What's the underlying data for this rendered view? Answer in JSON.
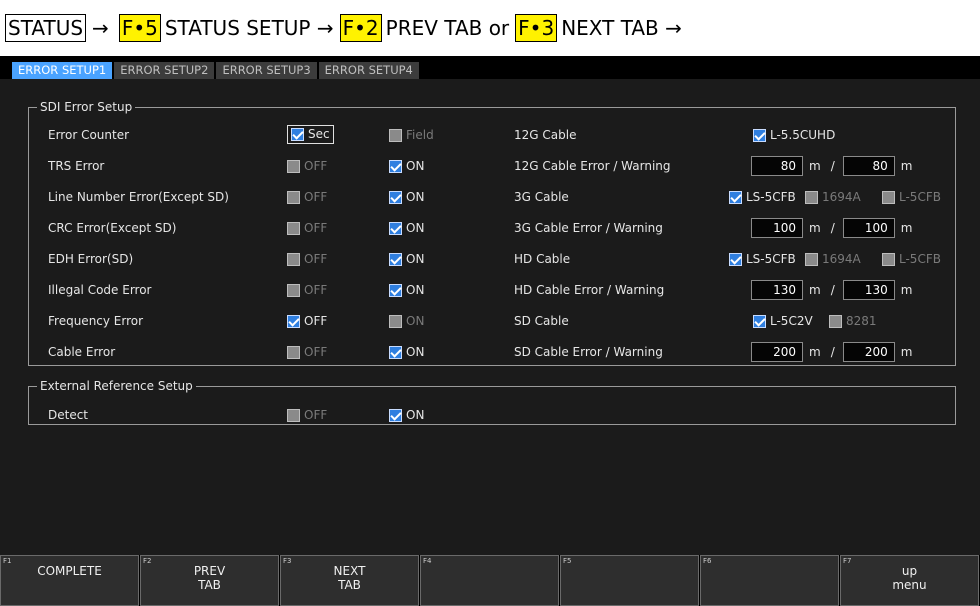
{
  "header": {
    "status": "STATUS",
    "arrow": "→",
    "f5_key": "F•5",
    "f5_text": "STATUS SETUP →",
    "f2_key": "F•2",
    "f2_text": "PREV TAB or",
    "f3_key": "F•3",
    "f3_text": "NEXT TAB →"
  },
  "tabs": [
    "ERROR SETUP1",
    "ERROR SETUP2",
    "ERROR SETUP3",
    "ERROR SETUP4"
  ],
  "sdi": {
    "legend": "SDI Error Setup",
    "rows": [
      {
        "label": "Error Counter",
        "a": {
          "text": "Sec",
          "checked": true
        },
        "b": {
          "text": "Field",
          "checked": false
        }
      },
      {
        "label": "TRS Error",
        "a": {
          "text": "OFF",
          "checked": false
        },
        "b": {
          "text": "ON",
          "checked": true
        }
      },
      {
        "label": "Line Number Error(Except SD)",
        "a": {
          "text": "OFF",
          "checked": false
        },
        "b": {
          "text": "ON",
          "checked": true
        }
      },
      {
        "label": "CRC Error(Except SD)",
        "a": {
          "text": "OFF",
          "checked": false
        },
        "b": {
          "text": "ON",
          "checked": true
        }
      },
      {
        "label": "EDH Error(SD)",
        "a": {
          "text": "OFF",
          "checked": false
        },
        "b": {
          "text": "ON",
          "checked": true
        }
      },
      {
        "label": "Illegal Code Error",
        "a": {
          "text": "OFF",
          "checked": false
        },
        "b": {
          "text": "ON",
          "checked": true
        }
      },
      {
        "label": "Frequency Error",
        "a": {
          "text": "OFF",
          "checked": true
        },
        "b": {
          "text": "ON",
          "checked": false
        }
      },
      {
        "label": "Cable Error",
        "a": {
          "text": "OFF",
          "checked": false
        },
        "b": {
          "text": "ON",
          "checked": true
        }
      }
    ],
    "cable": {
      "g12_label": "12G Cable",
      "g12_opt": "L-5.5CUHD",
      "g12_err_label": "12G Cable Error / Warning",
      "g12_err": "80",
      "g12_warn": "80",
      "g3_label": "3G Cable",
      "g3_opts": [
        "LS-5CFB",
        "1694A",
        "L-5CFB"
      ],
      "g3_err_label": "3G Cable Error / Warning",
      "g3_err": "100",
      "g3_warn": "100",
      "hd_label": "HD Cable",
      "hd_opts": [
        "LS-5CFB",
        "1694A",
        "L-5CFB"
      ],
      "hd_err_label": "HD Cable Error / Warning",
      "hd_err": "130",
      "hd_warn": "130",
      "sd_label": "SD Cable",
      "sd_opts": [
        "L-5C2V",
        "8281"
      ],
      "sd_err_label": "SD Cable Error / Warning",
      "sd_err": "200",
      "sd_warn": "200",
      "unit": "m",
      "slash": "/"
    }
  },
  "ext": {
    "legend": "External Reference Setup",
    "label": "Detect",
    "off": "OFF",
    "on": "ON"
  },
  "fkeys": [
    {
      "num": "F1",
      "label": "COMPLETE"
    },
    {
      "num": "F2",
      "label": "PREV\nTAB"
    },
    {
      "num": "F3",
      "label": "NEXT\nTAB"
    },
    {
      "num": "F4",
      "label": ""
    },
    {
      "num": "F5",
      "label": ""
    },
    {
      "num": "F6",
      "label": ""
    },
    {
      "num": "F7",
      "label": "up\nmenu"
    }
  ],
  "colors": {
    "accent": "#4aa3ff",
    "checkbox_on": "#2f7fe0",
    "key_highlight": "#fff200"
  }
}
